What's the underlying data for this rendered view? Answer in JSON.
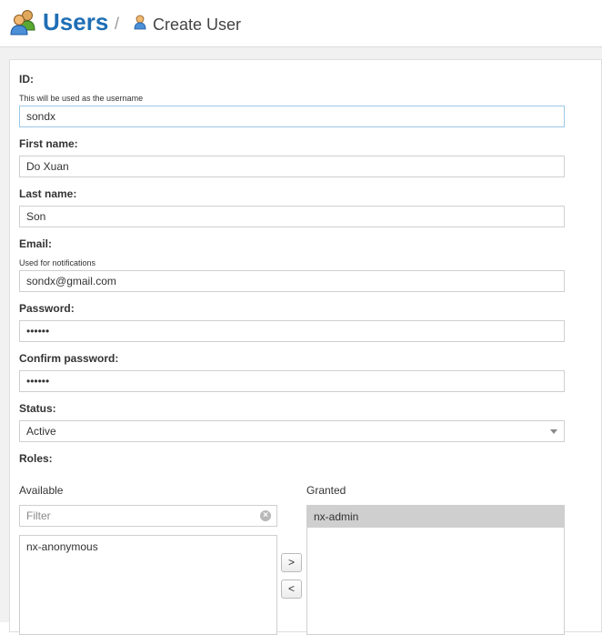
{
  "header": {
    "title": "Users",
    "separator": "/",
    "current_page": "Create User"
  },
  "form": {
    "id": {
      "label": "ID:",
      "help": "This will be used as the username",
      "value": "sondx"
    },
    "first_name": {
      "label": "First name:",
      "value": "Do Xuan"
    },
    "last_name": {
      "label": "Last name:",
      "value": "Son"
    },
    "email": {
      "label": "Email:",
      "help": "Used for notifications",
      "value": "sondx@gmail.com"
    },
    "password": {
      "label": "Password:",
      "value": "••••••"
    },
    "confirm_password": {
      "label": "Confirm password:",
      "value": "••••••"
    },
    "status": {
      "label": "Status:",
      "value": "Active"
    },
    "roles": {
      "label": "Roles:",
      "available_title": "Available",
      "granted_title": "Granted",
      "filter_placeholder": "Filter",
      "clear_symbol": "×",
      "available_items": [
        "nx-anonymous"
      ],
      "granted_items": [
        "nx-admin"
      ],
      "add_label": ">",
      "remove_label": "<"
    }
  },
  "colors": {
    "brand_blue": "#1f6eb5",
    "selected_item": "#cfcfcf",
    "focus_border": "#9bc8e6"
  },
  "icons": {
    "header": "users-icon",
    "breadcrumb": "user-icon"
  }
}
